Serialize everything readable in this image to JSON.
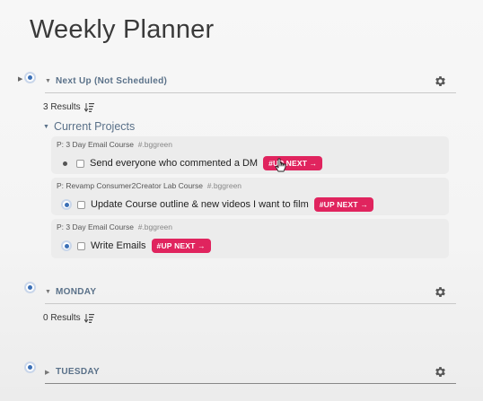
{
  "page": {
    "title": "Weekly Planner"
  },
  "sections": [
    {
      "title": "Next Up (Not Scheduled)",
      "results": "3 Results",
      "groups": [
        {
          "heading": "Current Projects",
          "tasks": [
            {
              "project": "P: 3 Day Email Course",
              "project_tag": "#.bggreen",
              "text": "Send everyone who commented a DM",
              "tag": "#UP NEXT →"
            },
            {
              "project": "P: Revamp Consumer2Creator Lab Course",
              "project_tag": "#.bggreen",
              "text": "Update Course outline & new videos I want to film",
              "tag": "#UP NEXT →"
            },
            {
              "project": "P: 3 Day Email Course",
              "project_tag": "#.bggreen",
              "text": "Write Emails",
              "tag": "#UP NEXT →"
            }
          ]
        }
      ]
    },
    {
      "title": "MONDAY",
      "results": "0 Results"
    },
    {
      "title": "TUESDAY"
    }
  ],
  "colors": {
    "accent_tag": "#e0245e",
    "section_title": "#5a7189",
    "bullet": "#3b6fb6"
  },
  "icons": [
    "gear-icon",
    "sort-icon",
    "chevron-down-icon",
    "chevron-right-icon",
    "bullet-icon",
    "cursor-icon"
  ]
}
